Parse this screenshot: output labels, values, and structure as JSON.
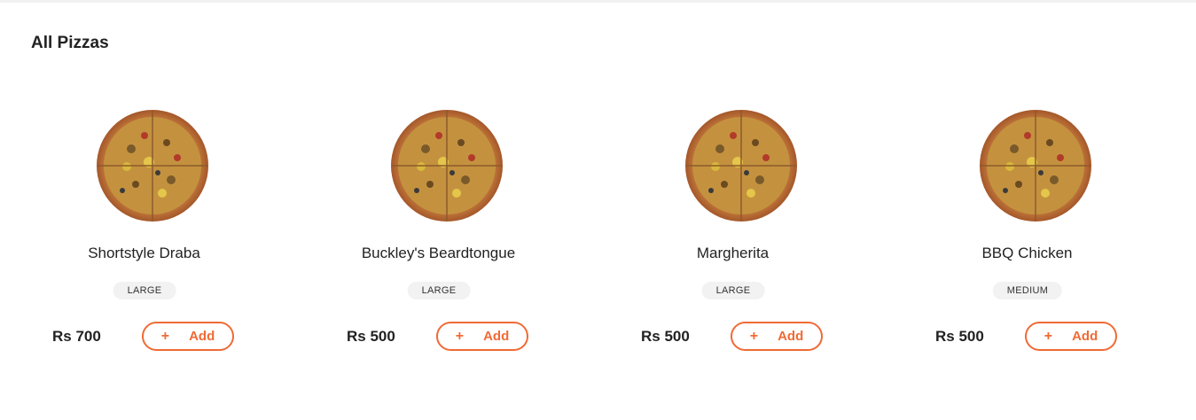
{
  "section": {
    "title": "All Pizzas"
  },
  "colors": {
    "accent": "#f06a35",
    "badge_bg": "#f2f2f2"
  },
  "products": [
    {
      "name": "Shortstyle Draba",
      "size": "LARGE",
      "price": "Rs 700",
      "add_label": "Add",
      "add_icon": "plus-icon"
    },
    {
      "name": "Buckley's Beardtongue",
      "size": "LARGE",
      "price": "Rs 500",
      "add_label": "Add",
      "add_icon": "plus-icon"
    },
    {
      "name": "Margherita",
      "size": "LARGE",
      "price": "Rs 500",
      "add_label": "Add",
      "add_icon": "plus-icon"
    },
    {
      "name": "BBQ Chicken",
      "size": "MEDIUM",
      "price": "Rs 500",
      "add_label": "Add",
      "add_icon": "plus-icon"
    }
  ]
}
